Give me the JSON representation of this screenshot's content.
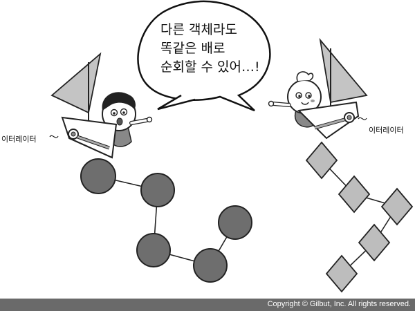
{
  "speech_bubble": {
    "lines": [
      "다른 객체라도",
      "똑같은 배로",
      "순회할 수 있어…!"
    ]
  },
  "labels": {
    "left_iterator": "이터레이터",
    "right_iterator": "이터레이터"
  },
  "footer": {
    "copyright": "Copyright © Gilbut, Inc. All rights reserved."
  },
  "colors": {
    "node_circle": "#6e6e6e",
    "node_diamond": "#bdbdbd",
    "sail": "#c4c4c4",
    "footer_bar": "#6a6a6a"
  }
}
